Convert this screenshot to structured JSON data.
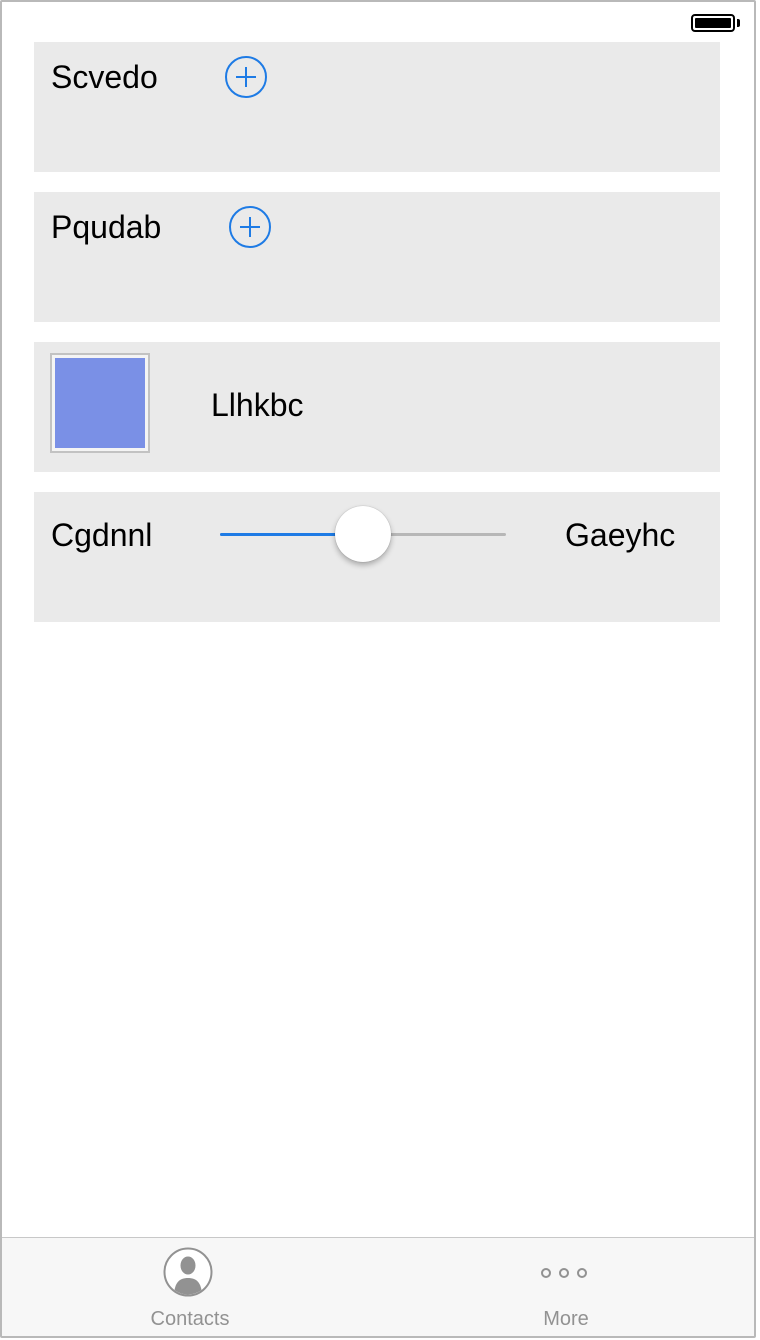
{
  "status_bar": {
    "battery_icon": "battery-full-icon"
  },
  "cells": [
    {
      "label": "Scvedo",
      "accessory_icon": "add-circle-icon"
    },
    {
      "label": "Pqudab",
      "accessory_icon": "add-circle-icon"
    },
    {
      "label": "Llhkbc",
      "swatch_color": "#7a90e6"
    },
    {
      "min_label": "Cgdnnl",
      "max_label": "Gaeyhc",
      "slider_value": 0.5
    }
  ],
  "tab_bar": {
    "tabs": [
      {
        "label": "Contacts",
        "icon": "contacts-icon"
      },
      {
        "label": "More",
        "icon": "more-icon"
      }
    ]
  },
  "colors": {
    "accent": "#1e7be5",
    "cell_background": "#eaeaea",
    "tab_inactive": "#929292",
    "slider_track": "#b7b7b7"
  }
}
